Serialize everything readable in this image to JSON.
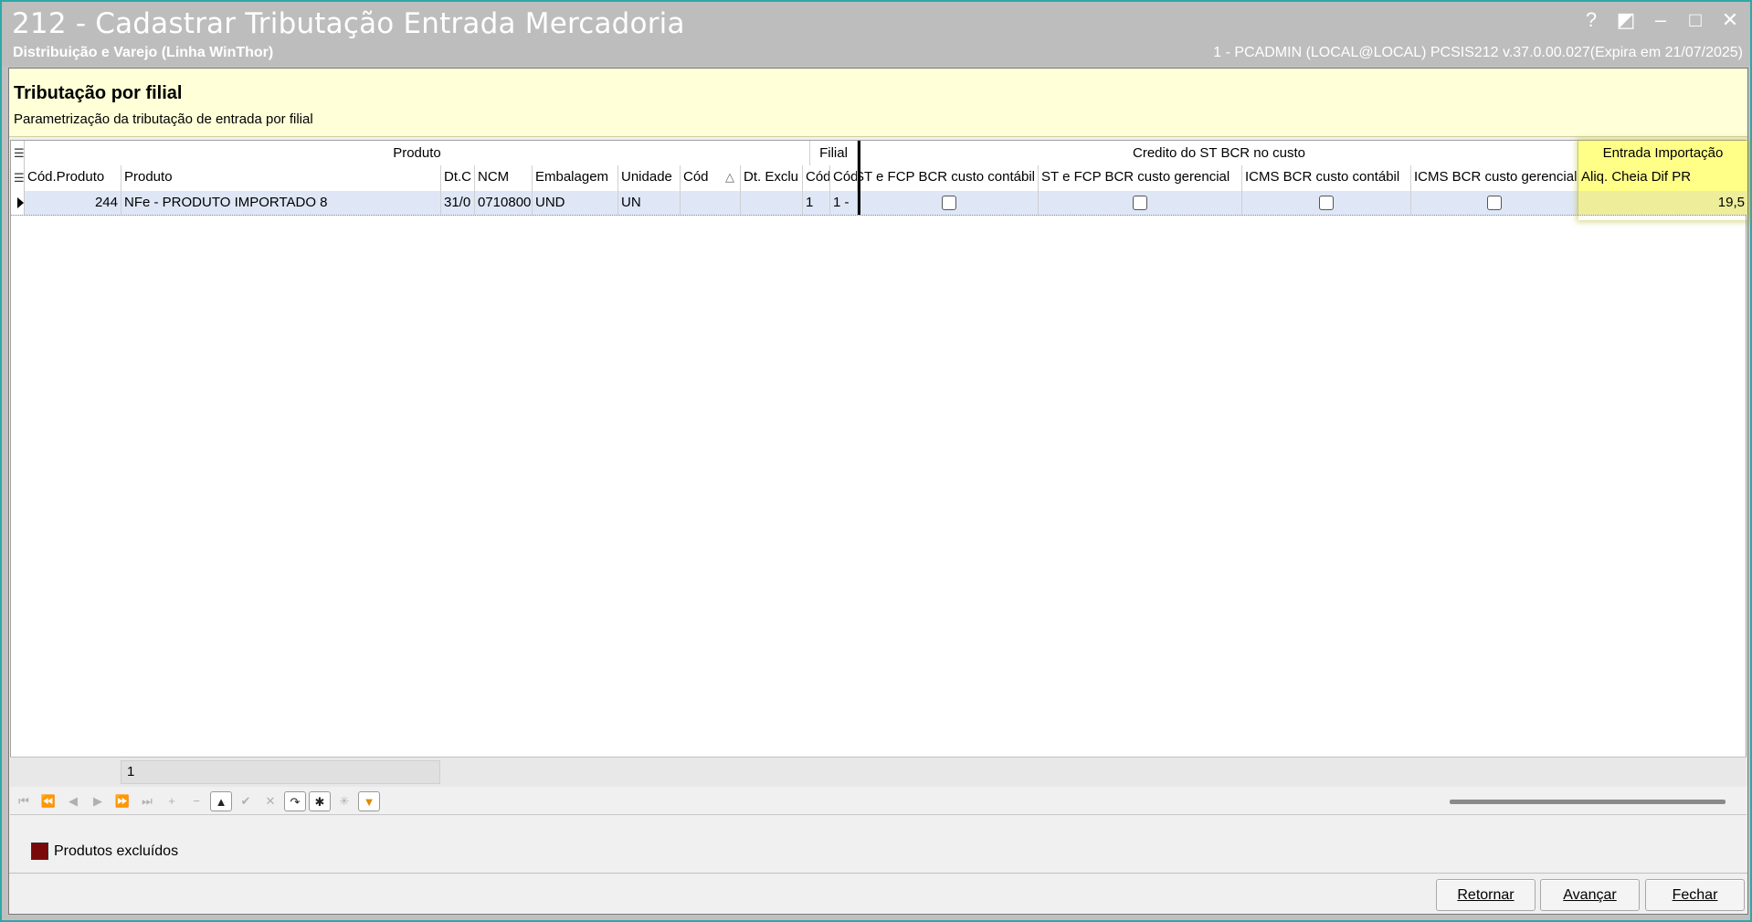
{
  "window": {
    "title": "212 - Cadastrar Tributação Entrada Mercadoria",
    "subtitle": "Distribuição e Varejo (Linha WinThor)",
    "session_info": "1 - PCADMIN (LOCAL@LOCAL)   PCSIS212  v.37.0.00.027(Expira em 21/07/2025)",
    "controls": {
      "help": "?",
      "edit": "◩",
      "minimize": "–",
      "maximize": "□",
      "close": "✕"
    }
  },
  "panel": {
    "title": "Tributação por filial",
    "subtitle": "Parametrização da tributação de entrada por filial"
  },
  "grid": {
    "bands": {
      "produto": "Produto",
      "filial": "Filial",
      "credito": "Credito do ST BCR no custo",
      "entrada": "Entrada Importação"
    },
    "columns": {
      "cod_produto": "Cód.Produto",
      "produto": "Produto",
      "dt_cad": "Dt.C",
      "ncm": "NCM",
      "embalagem": "Embalagem",
      "unidade": "Unidade",
      "cod": "Cód",
      "sort_indicator": "△",
      "dt_excl": "Dt. Exclu",
      "filial_cod1": "Cód",
      "filial_cod2": "Cód",
      "st_fcp_contabil": "ST e FCP BCR custo contábil",
      "st_fcp_gerencial": "ST e FCP BCR custo gerencial",
      "icms_contabil": "ICMS BCR custo contábil",
      "icms_gerencial": "ICMS BCR custo gerencial",
      "aliq": "Aliq. Cheia Dif PR"
    },
    "rows": [
      {
        "cod_produto": "244",
        "produto": "NFe - PRODUTO IMPORTADO 8",
        "dt_cad": "31/0",
        "ncm": "0710800",
        "embalagem": "UND",
        "unidade": "UN",
        "cod": "",
        "dt_excl": "",
        "filial_cod1": "1",
        "filial_cod2": "1 -",
        "st_fcp_contabil": false,
        "st_fcp_gerencial": false,
        "icms_contabil": false,
        "icms_gerencial": false,
        "aliq": "19,5"
      }
    ],
    "footer_count": "1"
  },
  "navigator": {
    "buttons": [
      "⏮",
      "⏪",
      "◀",
      "▶",
      "⏩",
      "⏭",
      "+",
      "−",
      "▲",
      "✔",
      "✕",
      "↷",
      "✱",
      "✳",
      "▼"
    ]
  },
  "legend": {
    "label": "Produtos excluídos",
    "color": "#7a0a0a"
  },
  "actions": {
    "back": "Retornar",
    "next": "Avançar",
    "close": "Fechar"
  }
}
